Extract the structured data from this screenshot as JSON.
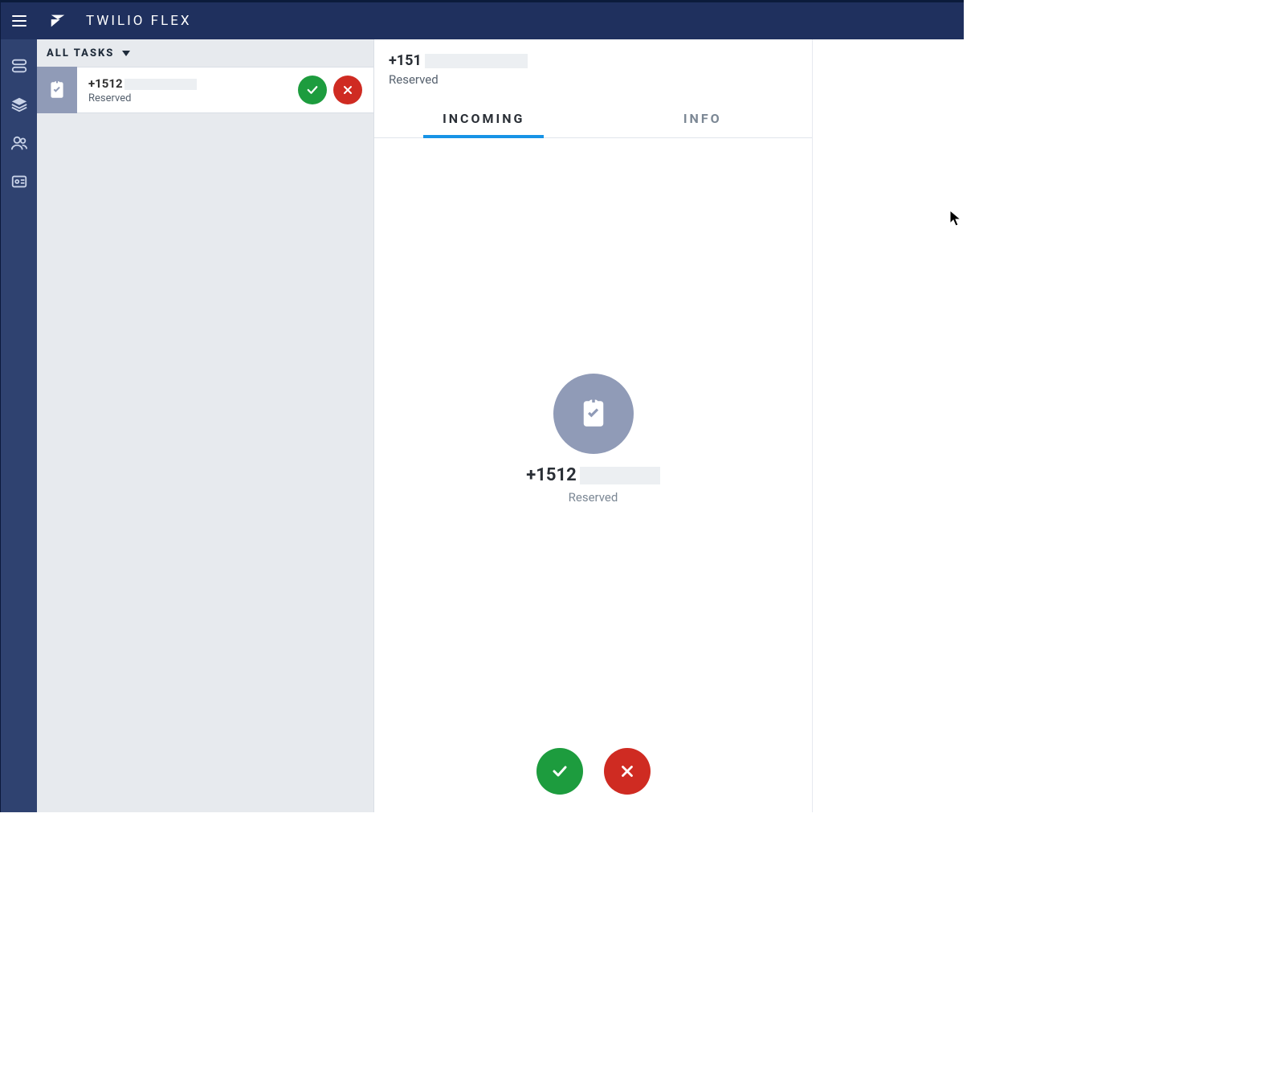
{
  "topbar": {
    "title": "TWILIO FLEX"
  },
  "sidebar": {
    "items": [
      {
        "name": "agent-desktop",
        "icon": "tasks"
      },
      {
        "name": "queues",
        "icon": "layers"
      },
      {
        "name": "teams",
        "icon": "people"
      },
      {
        "name": "admin",
        "icon": "id-card"
      }
    ]
  },
  "tasklist": {
    "filter_label": "ALL TASKS",
    "tasks": [
      {
        "phone_prefix": "+1512",
        "status": "Reserved"
      }
    ]
  },
  "detail": {
    "header_phone_prefix": "+151",
    "header_status": "Reserved",
    "tabs": [
      {
        "label": "INCOMING",
        "active": true
      },
      {
        "label": "INFO",
        "active": false
      }
    ],
    "incoming": {
      "phone_prefix": "+1512",
      "status": "Reserved"
    }
  }
}
